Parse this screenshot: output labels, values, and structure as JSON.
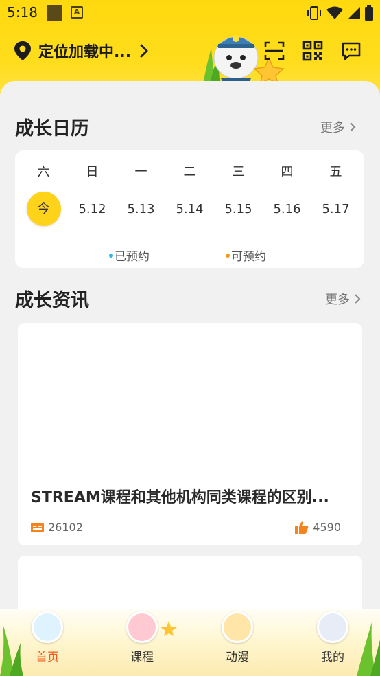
{
  "status_bar": {
    "time": "5:18"
  },
  "header": {
    "location": "定位加载中..."
  },
  "calendar": {
    "title": "成长日历",
    "more": "更多",
    "weekdays": [
      "六",
      "日",
      "一",
      "二",
      "三",
      "四",
      "五"
    ],
    "dates": [
      "今",
      "5.12",
      "5.13",
      "5.14",
      "5.15",
      "5.16",
      "5.17"
    ],
    "legend": {
      "booked": "已预约",
      "available": "可预约"
    },
    "colors": {
      "booked": "#29b8e8",
      "available": "#f39a1e",
      "today": "#ffd31a"
    }
  },
  "news": {
    "title": "成长资讯",
    "more": "更多",
    "items": [
      {
        "title": "STREAM课程和其他机构同类课程的区别...",
        "views": "26102",
        "likes": "4590"
      }
    ]
  },
  "tabbar": {
    "tabs": [
      {
        "label": "首页"
      },
      {
        "label": "课程"
      },
      {
        "label": "动漫"
      },
      {
        "label": "我的"
      }
    ],
    "active_color": "#f2591e"
  }
}
